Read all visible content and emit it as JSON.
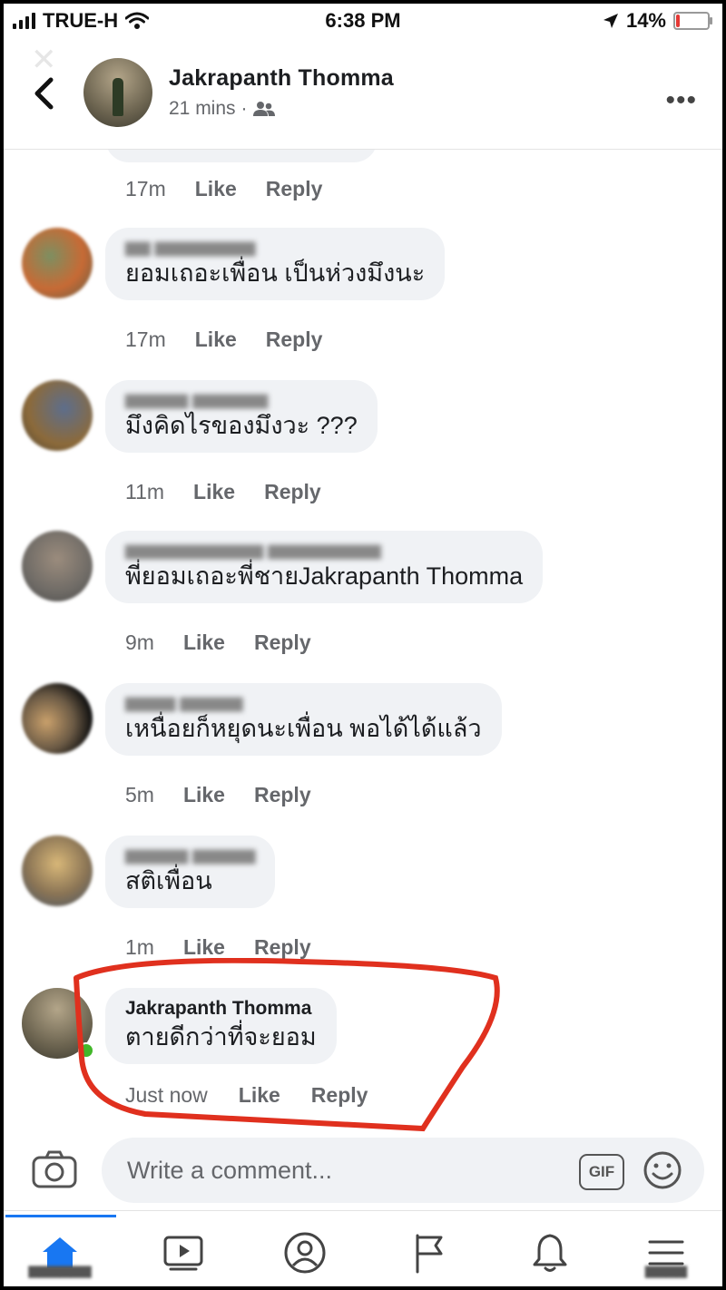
{
  "status_bar": {
    "carrier": "TRUE-H",
    "time": "6:38 PM",
    "battery": "14%",
    "battery_level": 0.14,
    "icons": [
      "signal-icon",
      "wifi-icon",
      "location-arrow-icon",
      "battery-icon"
    ]
  },
  "header": {
    "name": "Jakrapanth Thomma",
    "meta": "21 mins",
    "separator": "·",
    "icons": [
      "back-chevron-icon",
      "friends-audience-icon",
      "more-dots-icon"
    ]
  },
  "comments": [
    {
      "author": "",
      "text": "",
      "time": "17m",
      "like": "Like",
      "reply": "Reply"
    },
    {
      "author": "",
      "text": "ยอมเถอะเพื่อน เป็นห่วงมึงนะ",
      "time": "17m",
      "like": "Like",
      "reply": "Reply"
    },
    {
      "author": "",
      "text": "มึงคิดไรของมึงวะ ???",
      "time": "11m",
      "like": "Like",
      "reply": "Reply"
    },
    {
      "author": "",
      "text": "พี่ยอมเถอะพี่ชายJakrapanth Thomma",
      "time": "9m",
      "like": "Like",
      "reply": "Reply"
    },
    {
      "author": "",
      "text": "เหนื่อยก็หยุดนะเพื่อน พอได้ได้แล้ว",
      "time": "5m",
      "like": "Like",
      "reply": "Reply"
    },
    {
      "author": "",
      "text": "สติเพื่อน",
      "time": "1m",
      "like": "Like",
      "reply": "Reply"
    },
    {
      "author": "Jakrapanth Thomma",
      "text": "ตายดีกว่าที่จะยอม",
      "time": "Just now",
      "like": "Like",
      "reply": "Reply"
    }
  ],
  "composer": {
    "placeholder": "Write a comment...",
    "gif_label": "GIF",
    "icons": [
      "camera-icon",
      "emoji-icon"
    ]
  },
  "tabbar": {
    "tabs": [
      {
        "icon": "home-icon",
        "active": true
      },
      {
        "icon": "watch-video-icon",
        "active": false
      },
      {
        "icon": "profile-icon",
        "active": false
      },
      {
        "icon": "pages-flag-icon",
        "active": false
      },
      {
        "icon": "notifications-bell-icon",
        "active": false
      },
      {
        "icon": "menu-icon",
        "active": false
      }
    ]
  },
  "colors": {
    "accent": "#1877f2",
    "bubble": "#f0f2f5",
    "highlight_circle": "#e0301e",
    "online": "#42b72a"
  }
}
